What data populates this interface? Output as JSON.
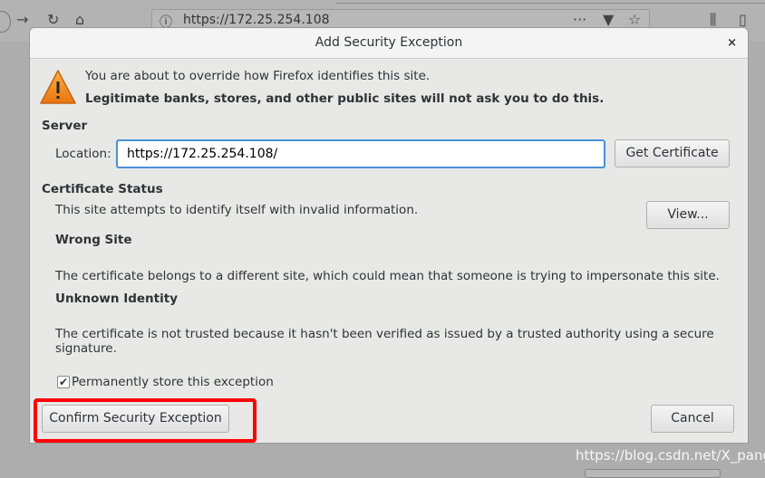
{
  "browser": {
    "url": "https://172.25.254.108"
  },
  "dialog": {
    "title": "Add Security Exception",
    "close": "×",
    "warning_line1": "You are about to override how Firefox identifies this site.",
    "warning_line2": "Legitimate banks, stores, and other public sites will not ask you to do this.",
    "server_heading": "Server",
    "location_label": "Location:",
    "location_value": "https://172.25.254.108/",
    "get_certificate": "Get Certificate",
    "status_heading": "Certificate Status",
    "status_text": "This site attempts to identify itself with invalid information.",
    "view_button": "View...",
    "issues": [
      {
        "title": "Wrong Site",
        "text": "The certificate belongs to a different site, which could mean that someone is trying to impersonate this site."
      },
      {
        "title": "Unknown Identity",
        "text": "The certificate is not trusted because it hasn't been verified as issued by a trusted authority using a secure signature."
      }
    ],
    "permanent_label": "Permanently store this exception",
    "permanent_checked": true,
    "confirm_button": "Confirm Security Exception",
    "cancel_button": "Cancel"
  },
  "watermark": "https://blog.csdn.net/X_pang",
  "colors": {
    "highlight": "#ff0000",
    "focus": "#4a90d9",
    "warning": "#f08c1c"
  }
}
